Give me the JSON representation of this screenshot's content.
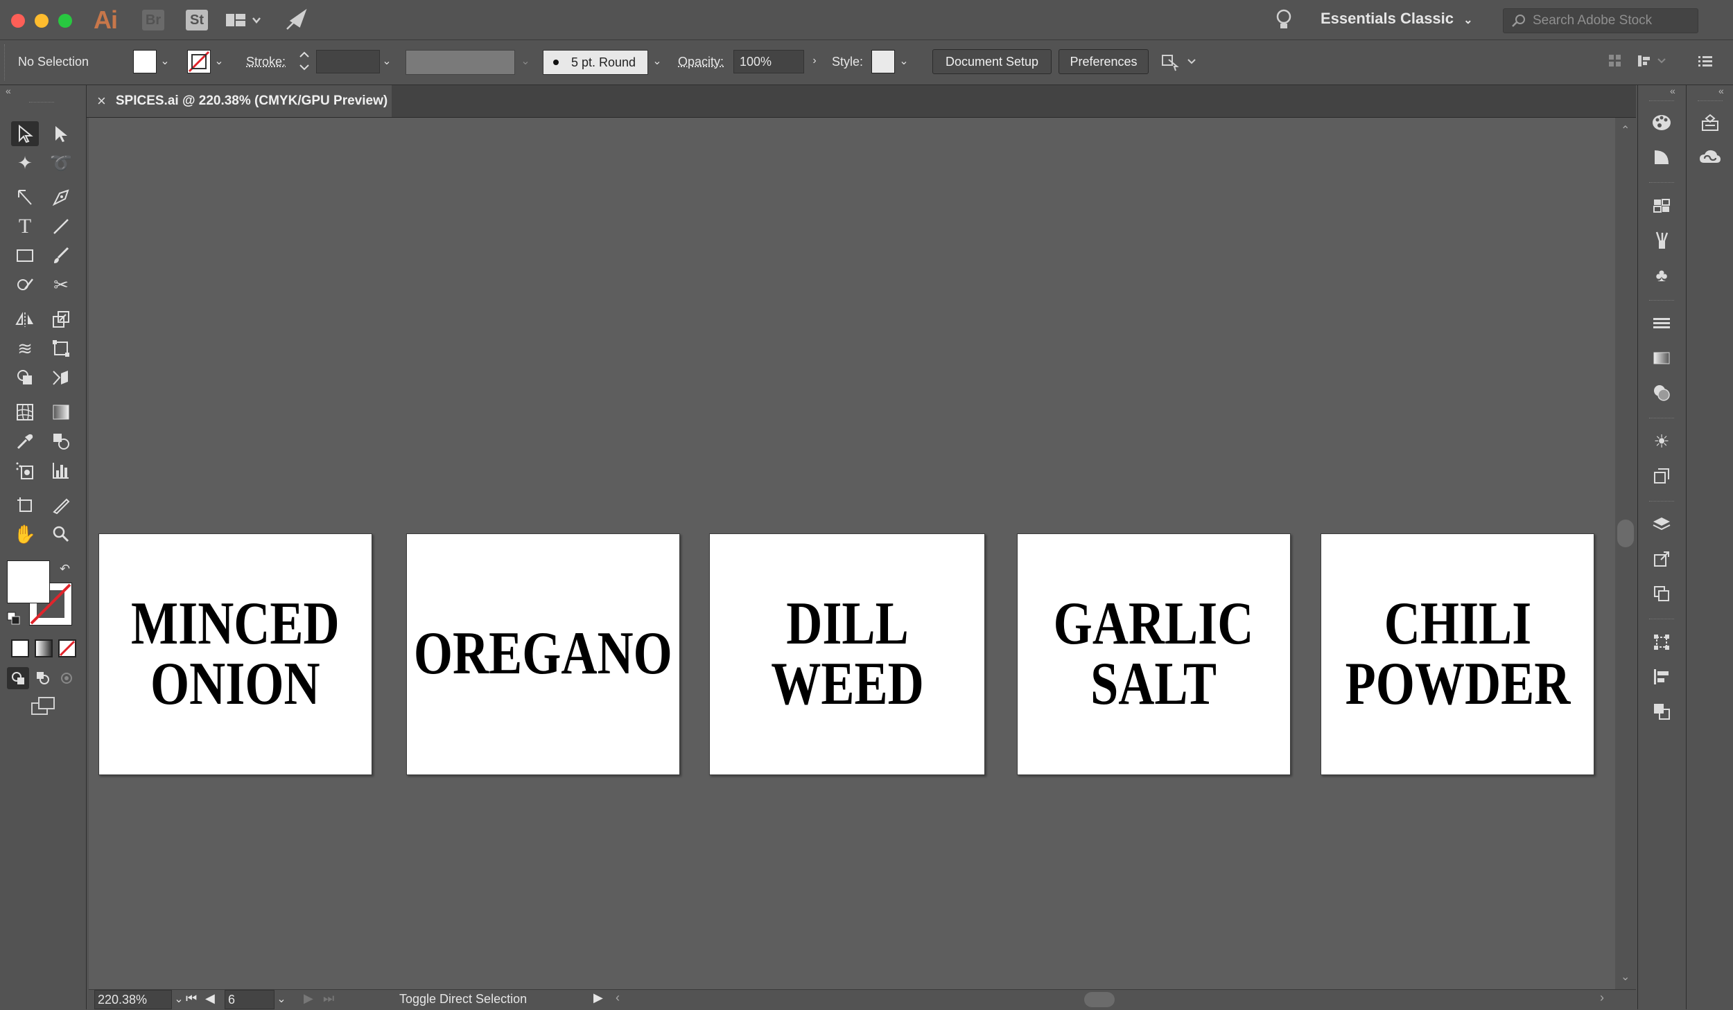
{
  "app": {
    "logo": "Ai",
    "bridge_label": "Br",
    "stock_label": "St",
    "workspace": "Essentials Classic",
    "search_placeholder": "Search Adobe Stock"
  },
  "control_bar": {
    "selection_status": "No Selection",
    "stroke_label": "Stroke:",
    "brush_label": "5 pt. Round",
    "opacity_label": "Opacity:",
    "opacity_value": "100%",
    "style_label": "Style:",
    "document_setup_label": "Document Setup",
    "preferences_label": "Preferences"
  },
  "document": {
    "tab_title": "SPICES.ai @ 220.38% (CMYK/GPU Preview)",
    "close_glyph": "×"
  },
  "artboards": [
    {
      "line1": "MINCED",
      "line2": "ONION"
    },
    {
      "line1": "OREGANO",
      "line2": ""
    },
    {
      "line1": "DILL",
      "line2": "WEED"
    },
    {
      "line1": "GARLIC",
      "line2": "SALT"
    },
    {
      "line1": "CHILI",
      "line2": "POWDER"
    }
  ],
  "status_bar": {
    "zoom": "220.38%",
    "artboard_number": "6",
    "status_message": "Toggle Direct Selection"
  },
  "colors": {
    "app_bg": "#535353",
    "canvas_bg": "#5e5e5e",
    "artboard_bg": "#ffffff",
    "accent_ai": "#c8774a",
    "none_stroke_red": "#e0242b"
  }
}
